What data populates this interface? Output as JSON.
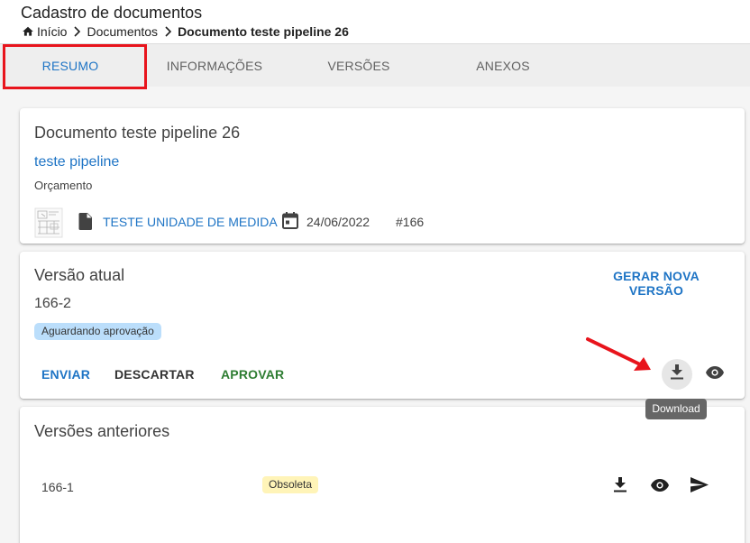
{
  "header": {
    "title": "Cadastro de documentos",
    "breadcrumb": {
      "home": "Início",
      "section": "Documentos",
      "current": "Documento teste pipeline 26"
    }
  },
  "tabs": [
    {
      "label": "RESUMO",
      "active": true
    },
    {
      "label": "INFORMAÇÕES",
      "active": false
    },
    {
      "label": "VERSÕES",
      "active": false
    },
    {
      "label": "ANEXOS",
      "active": false
    }
  ],
  "summary": {
    "title": "Documento teste pipeline 26",
    "link": "teste pipeline",
    "type": "Orçamento",
    "unit": "TESTE UNIDADE DE MEDIDA",
    "date": "24/06/2022",
    "id": "#166"
  },
  "current_version": {
    "title": "Versão atual",
    "generate_label": "GERAR NOVA VERSÃO",
    "number": "166-2",
    "status": "Aguardando aprovação",
    "actions": {
      "send": "ENVIAR",
      "discard": "DESCARTAR",
      "approve": "APROVAR"
    },
    "tooltip": "Download"
  },
  "previous_versions": {
    "title": "Versões anteriores",
    "rows": [
      {
        "version": "166-1",
        "status": "Obsoleta"
      }
    ]
  },
  "colors": {
    "accent": "#1e74c5",
    "approve": "#2e7d32",
    "highlight": "#e8141c",
    "status_chip": "#bbdefb",
    "obsolete_chip": "#fff4b8"
  },
  "icons": [
    "home-icon",
    "chevron-right-icon",
    "file-icon",
    "calendar-icon",
    "download-icon",
    "eye-icon",
    "send-icon"
  ]
}
